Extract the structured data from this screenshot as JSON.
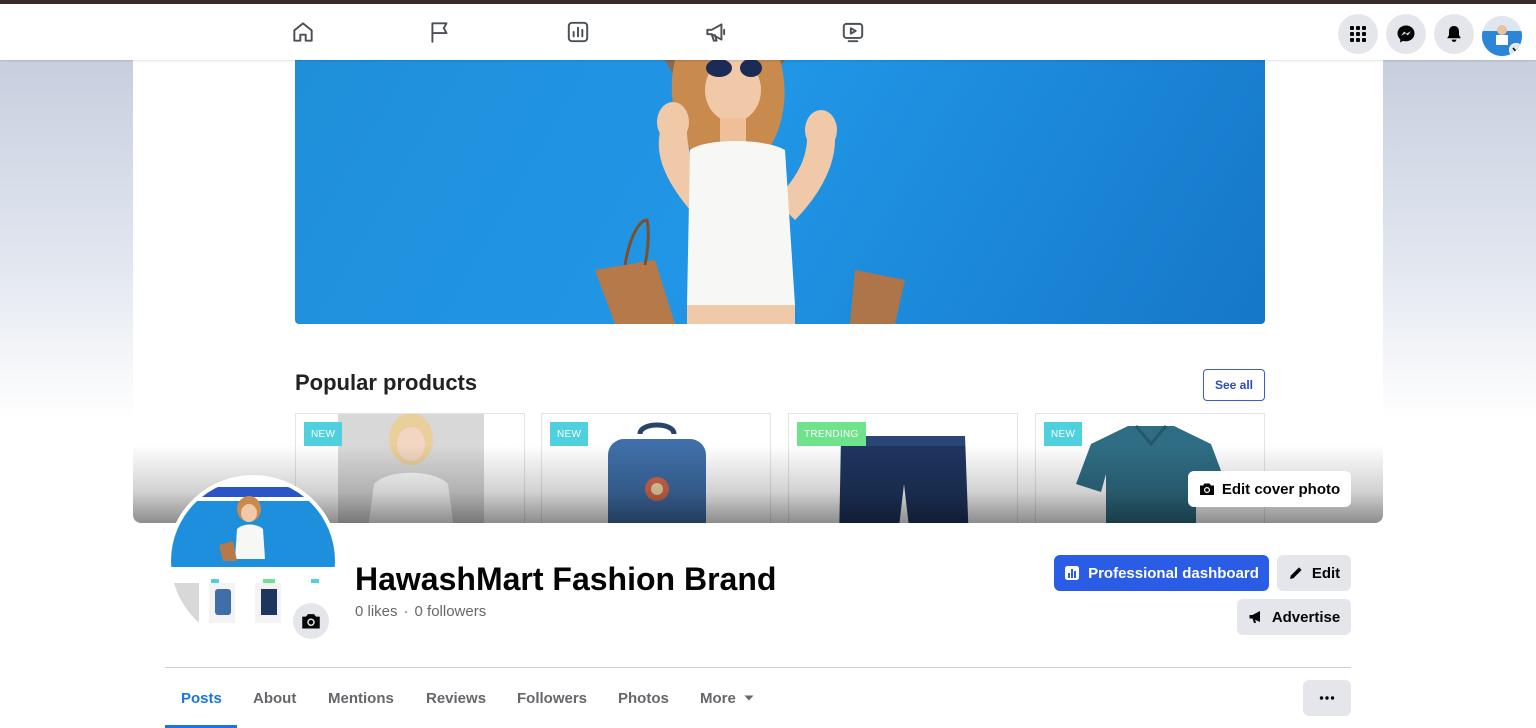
{
  "topnav": {
    "tabs": [
      {
        "name": "home-icon"
      },
      {
        "name": "flag-icon"
      },
      {
        "name": "insights-icon"
      },
      {
        "name": "megaphone-icon"
      },
      {
        "name": "video-icon"
      }
    ],
    "right_icons": [
      "apps-grid-icon",
      "messenger-icon",
      "notifications-bell-icon",
      "account-avatar"
    ]
  },
  "cover": {
    "section_title": "Popular products",
    "see_all_label": "See all",
    "products": [
      {
        "badge": "NEW"
      },
      {
        "badge": "NEW"
      },
      {
        "badge": "TRENDING"
      },
      {
        "badge": "NEW"
      }
    ],
    "edit_cover_label": "Edit cover photo"
  },
  "profile": {
    "name": "HawashMart Fashion Brand",
    "likes": "0 likes",
    "separator": "·",
    "followers": "0 followers",
    "professional_dashboard_label": "Professional dashboard",
    "edit_label": "Edit",
    "advertise_label": "Advertise"
  },
  "tabs": [
    {
      "label": "Posts",
      "active": true
    },
    {
      "label": "About"
    },
    {
      "label": "Mentions"
    },
    {
      "label": "Reviews"
    },
    {
      "label": "Followers"
    },
    {
      "label": "Photos"
    },
    {
      "label": "More"
    }
  ],
  "colors": {
    "primary_button": "#2a5ce6",
    "active_tab": "#1b74e4",
    "hero_blue": "#2196e6",
    "badge_new": "#4fd0de",
    "badge_trending": "#6ee38c"
  }
}
